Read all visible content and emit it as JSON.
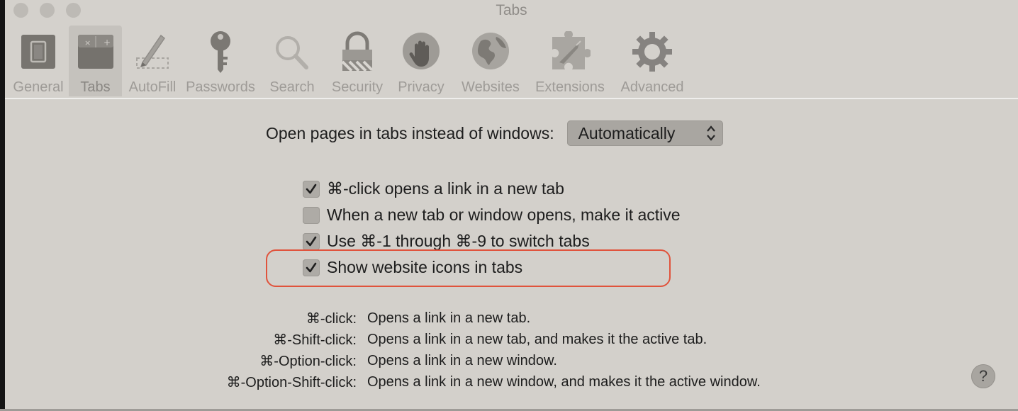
{
  "window": {
    "title": "Tabs"
  },
  "toolbar": {
    "tabs": [
      {
        "label": "General",
        "icon": "general-icon"
      },
      {
        "label": "Tabs",
        "icon": "tabs-icon",
        "selected": true
      },
      {
        "label": "AutoFill",
        "icon": "autofill-icon"
      },
      {
        "label": "Passwords",
        "icon": "key-icon"
      },
      {
        "label": "Search",
        "icon": "search-icon"
      },
      {
        "label": "Security",
        "icon": "lock-icon"
      },
      {
        "label": "Privacy",
        "icon": "hand-icon"
      },
      {
        "label": "Websites",
        "icon": "globe-icon"
      },
      {
        "label": "Extensions",
        "icon": "puzzle-icon"
      },
      {
        "label": "Advanced",
        "icon": "gear-icon"
      }
    ]
  },
  "settings": {
    "open_pages_label": "Open pages in tabs instead of windows:",
    "open_pages_value": "Automatically",
    "checkboxes": [
      {
        "label": "⌘-click opens a link in a new tab",
        "checked": true
      },
      {
        "label": "When a new tab or window opens, make it active",
        "checked": false
      },
      {
        "label": "Use ⌘-1 through ⌘-9 to switch tabs",
        "checked": true
      },
      {
        "label": "Show website icons in tabs",
        "checked": true
      }
    ]
  },
  "shortcuts": [
    {
      "key": "⌘-click:",
      "desc": "Opens a link in a new tab."
    },
    {
      "key": "⌘-Shift-click:",
      "desc": "Opens a link in a new tab, and makes it the active tab."
    },
    {
      "key": "⌘-Option-click:",
      "desc": "Opens a link in a new window."
    },
    {
      "key": "⌘-Option-Shift-click:",
      "desc": "Opens a link in a new window, and makes it the active window."
    }
  ],
  "help": {
    "label": "?"
  },
  "colors": {
    "highlight": "#e0533c"
  }
}
